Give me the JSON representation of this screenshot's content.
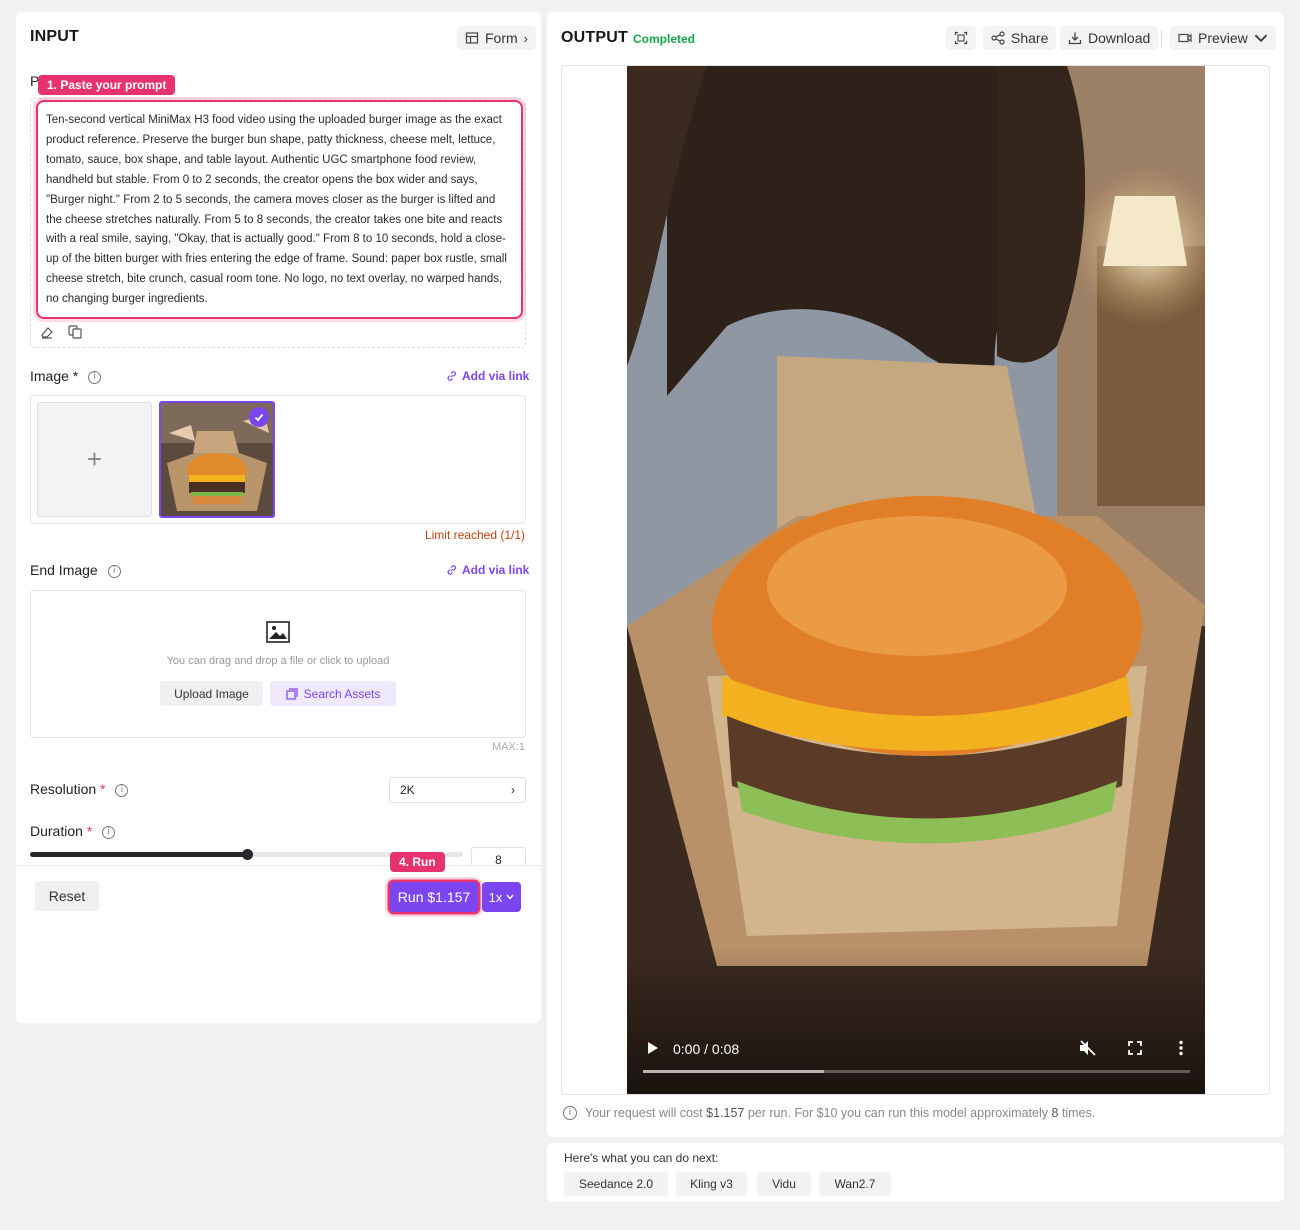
{
  "input": {
    "title": "INPUT",
    "form_label": "Form",
    "prompt_label_initial": "P",
    "callout_prompt": "1. Paste your prompt",
    "prompt_text": "Ten-second vertical MiniMax H3 food video using the uploaded burger image as the exact product reference. Preserve the burger bun shape, patty thickness, cheese melt, lettuce, tomato, sauce, box shape, and table layout. Authentic UGC smartphone food review, handheld but stable. From 0 to 2 seconds, the creator opens the box wider and says, \"Burger night.\" From 2 to 5 seconds, the camera moves closer as the burger is lifted and the cheese stretches naturally. From 5 to 8 seconds, the creator takes one bite and reacts with a real smile, saying, \"Okay, that is actually good.\" From 8 to 10 seconds, hold a close-up of the bitten burger with fries entering the edge of frame. Sound: paper box rustle, small cheese stretch, bite crunch, casual room tone. No logo, no text overlay, no warped hands, no changing burger ingredients.",
    "image_label": "Image",
    "add_via_link": "Add via link",
    "limit_text": "Limit reached (1/1)",
    "end_image_label": "End Image",
    "upload_hint": "You can drag and drop a file or click to upload",
    "upload_button": "Upload Image",
    "search_assets": "Search Assets",
    "max_text": "MAX:1",
    "resolution_label": "Resolution",
    "resolution_value": "2K",
    "duration_label": "Duration",
    "duration_value": "8",
    "duration_fraction": 0.5,
    "callout_run": "4. Run",
    "reset_button": "Reset",
    "run_button": "Run $1.157",
    "multiplier": "1x",
    "required_mark": "*"
  },
  "output": {
    "title": "OUTPUT",
    "status": "Completed",
    "share": "Share",
    "download": "Download",
    "preview": "Preview",
    "time_display": "0:00 / 0:08",
    "progress_fraction": 0.0,
    "buffered_fraction": 0.33,
    "cost_prefix": "Your request will cost ",
    "cost_value": "$1.157",
    "cost_mid": " per run. For $10 you can run this model approximately ",
    "cost_count": "8",
    "cost_suffix": " times."
  },
  "next": {
    "title": "Here's what you can do next:",
    "models": [
      "Seedance 2.0",
      "Kling v3",
      "Vidu",
      "Wan2.7"
    ]
  },
  "colors": {
    "accent": "#7b46f0",
    "highlight": "#e8336d",
    "success": "#16a34a",
    "warning": "#c2410c"
  }
}
